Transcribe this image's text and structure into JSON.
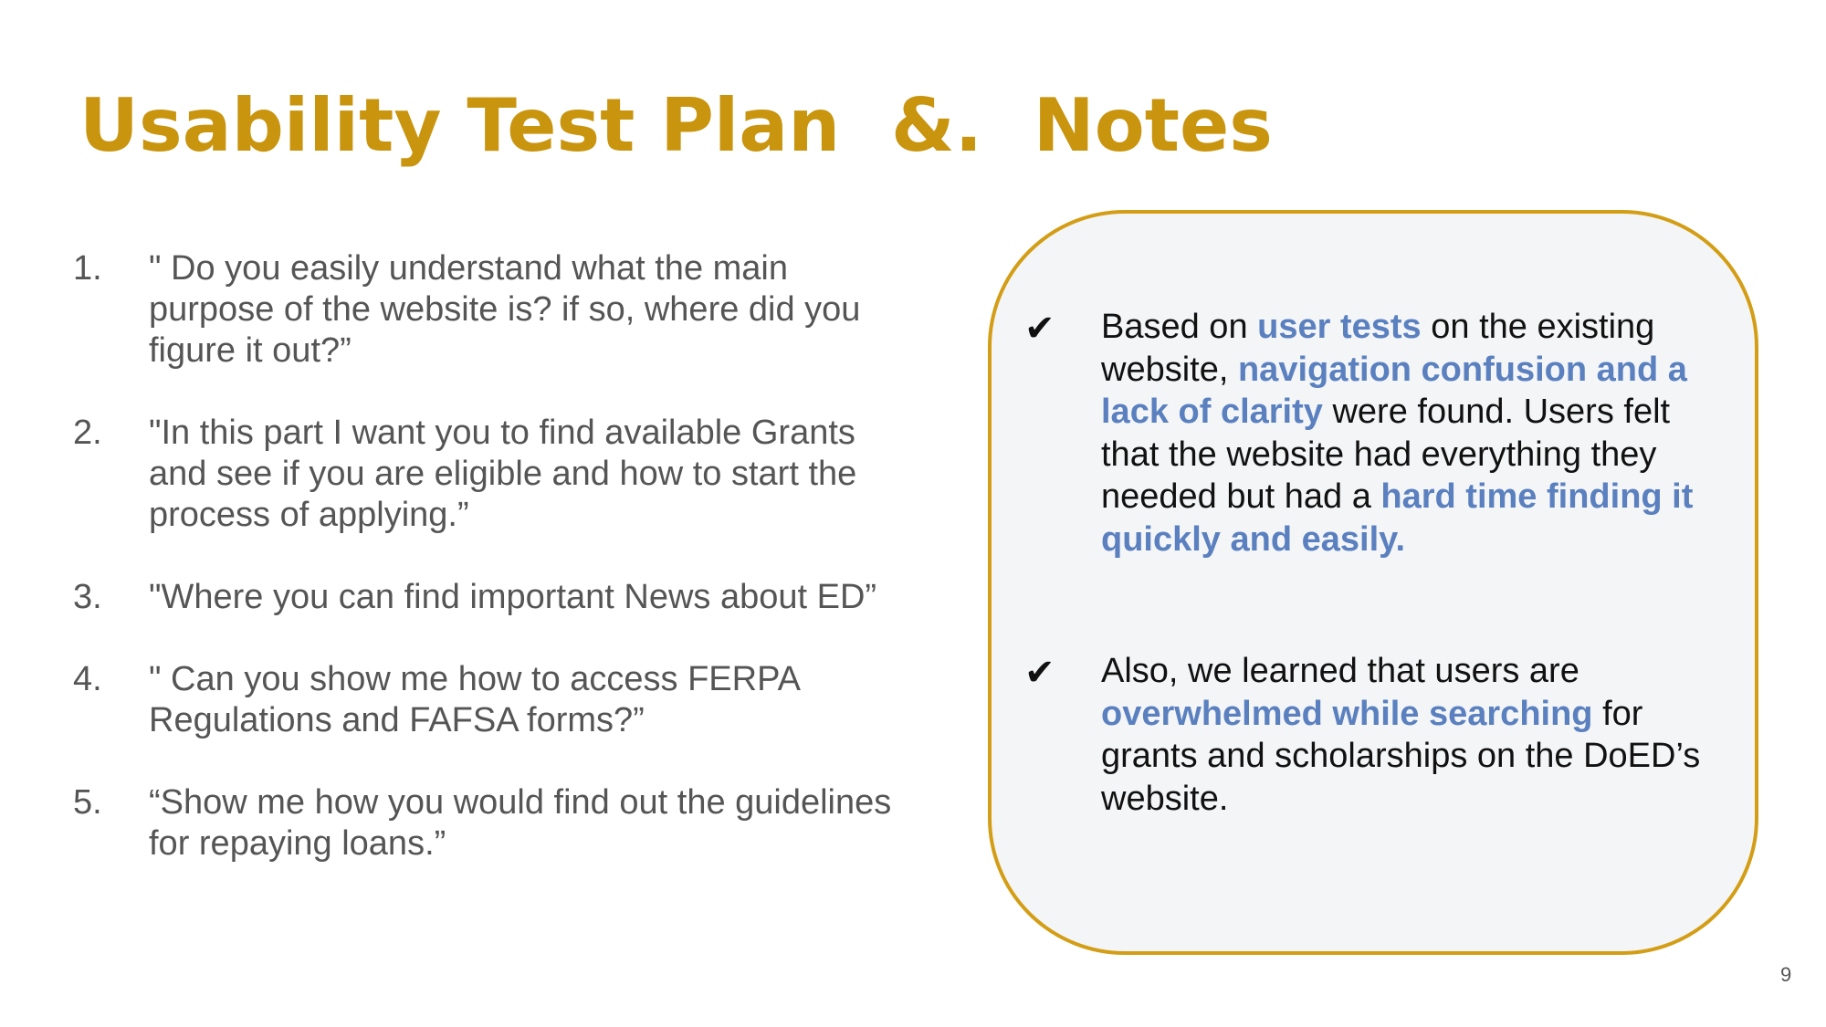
{
  "title": "Usability Test Plan  &.  Notes",
  "questions": [
    {
      "number": "1.",
      "text": "\" Do you easily understand what the main purpose of the website is? if so, where did you figure it out?”"
    },
    {
      "number": "2.",
      "text": "\"In this part I want you to find available Grants and see if you are eligible and how to start the process of applying.”"
    },
    {
      "number": "3.",
      "text": "\"Where you can find important News about ED”"
    },
    {
      "number": "4.",
      "text": "\" Can you show me how to access FERPA Regulations and FAFSA forms?”"
    },
    {
      "number": "5.",
      "text": "“Show me how you would find out the guidelines for repaying loans.”"
    }
  ],
  "notes": {
    "check_icon": "✔",
    "note1": {
      "p1": "Based on ",
      "h1": "user tests",
      "p2": " on the existing website, ",
      "h2": "navigation confusion and a lack of clarity",
      "p3": " were found. Users felt that the website had everything they needed but had a ",
      "h3": "hard time finding it quickly and easily."
    },
    "note2": {
      "p1": "Also, we learned that users are ",
      "h1": "overwhelmed while searching",
      "p2": " for grants and scholarships on the DoED’s website."
    }
  },
  "colors": {
    "title": "#c9950f",
    "box_border": "#d39e16",
    "box_fill": "#f4f5f7",
    "highlight": "#5a80bf",
    "body_text": "#555555"
  },
  "page_number": "9"
}
